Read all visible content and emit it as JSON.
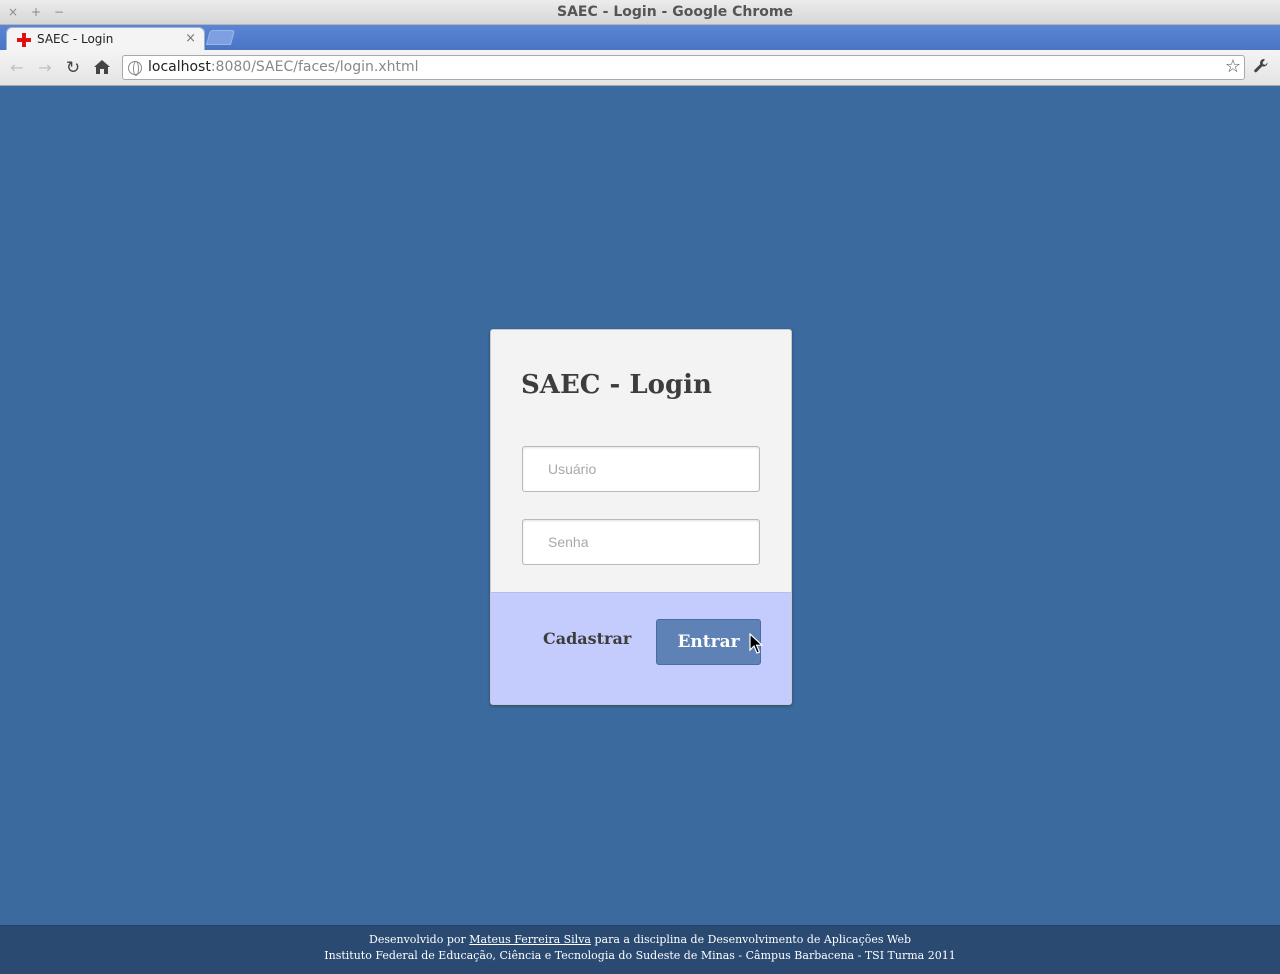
{
  "window": {
    "title": "SAEC - Login - Google Chrome",
    "controls": [
      "×",
      "+",
      "−"
    ]
  },
  "tab": {
    "title": "SAEC - Login",
    "close": "×"
  },
  "toolbar": {
    "url_host": "localhost",
    "url_rest": ":8080/SAEC/faces/login.xhtml",
    "icons": [
      "back-arrow-icon",
      "forward-arrow-icon",
      "reload-icon",
      "home-icon",
      "globe-icon",
      "star-icon",
      "wrench-icon"
    ]
  },
  "login": {
    "title": "SAEC - Login",
    "username_placeholder": "Usuário",
    "password_placeholder": "Senha",
    "register_label": "Cadastrar",
    "submit_label": "Entrar"
  },
  "footer": {
    "line1_prefix": "Desenvolvido por ",
    "author": "Mateus Ferreira Silva",
    "line1_suffix": " para a disciplina de Desenvolvimento de Aplicações Web",
    "line2": "Instituto Federal de Educação, Ciência e Tecnologia do Sudeste de Minas - Câmpus Barbacena - TSI Turma 2011"
  },
  "colors": {
    "page_background": "#3b6a9e",
    "card_footer": "#c3ccfd",
    "submit_button": "#5e82b5",
    "page_footer": "#2b4a72"
  }
}
